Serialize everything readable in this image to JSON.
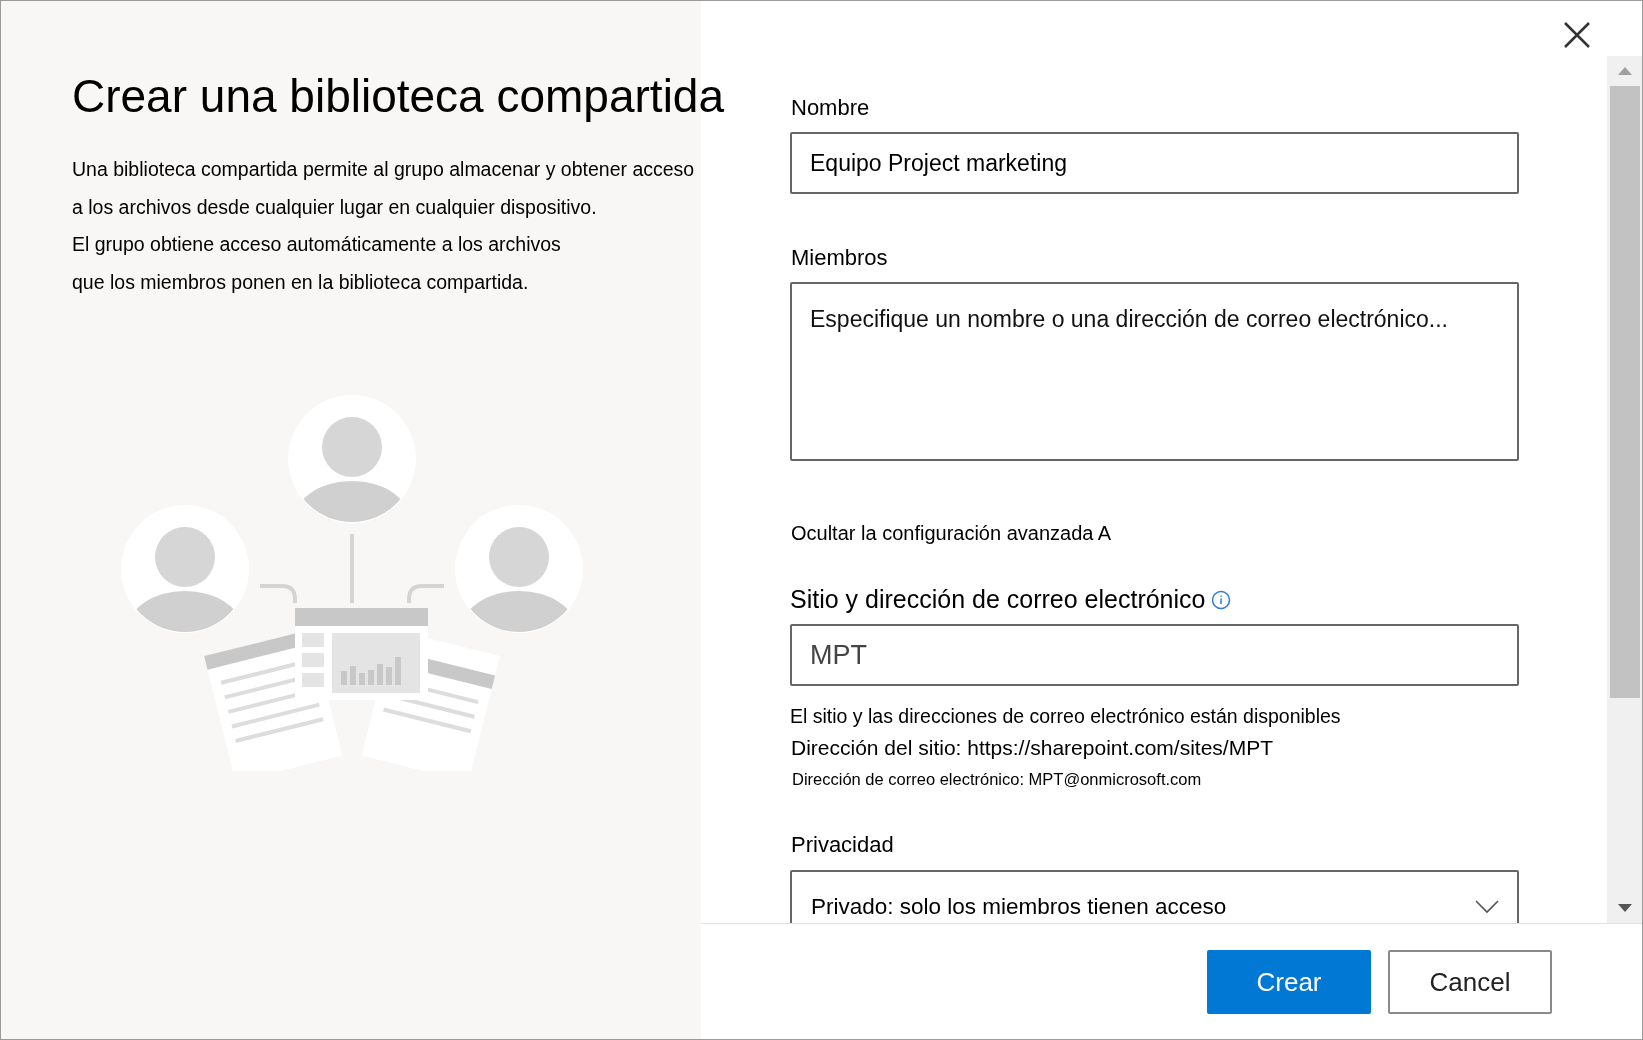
{
  "intro": {
    "title": "Crear una biblioteca compartida",
    "description": "Una biblioteca compartida permite al grupo almacenar y obtener acceso\na los archivos desde cualquier lugar en cualquier dispositivo.\nEl grupo obtiene acceso automáticamente a los archivos\nque los miembros ponen en la biblioteca compartida."
  },
  "form": {
    "sections": [
      {
        "kind": "text",
        "label": "Nombre",
        "value": "Equipo Project marketing"
      },
      {
        "kind": "textarea",
        "label": "Miembros",
        "placeholder": "Especifique un nombre o una dirección de correo electrónico..."
      },
      {
        "kind": "toggle",
        "label": "Ocultar la configuración avanzada A"
      },
      {
        "kind": "site",
        "label": "Sitio y dirección de correo electrónico",
        "value": "MPT",
        "notes": [
          "El sitio y las direcciones de correo electrónico están disponibles",
          "Dirección del sitio: https://sharepoint.com/sites/MPT",
          "Dirección de correo electrónico: MPT@onmicrosoft.com"
        ]
      },
      {
        "kind": "select",
        "label": "Privacidad",
        "value": "Privado: solo los miembros tienen acceso"
      }
    ]
  },
  "footer": {
    "buttons": [
      {
        "label": "Crear",
        "kind": "primary"
      },
      {
        "label": "Cancel",
        "kind": "secondary"
      }
    ]
  }
}
